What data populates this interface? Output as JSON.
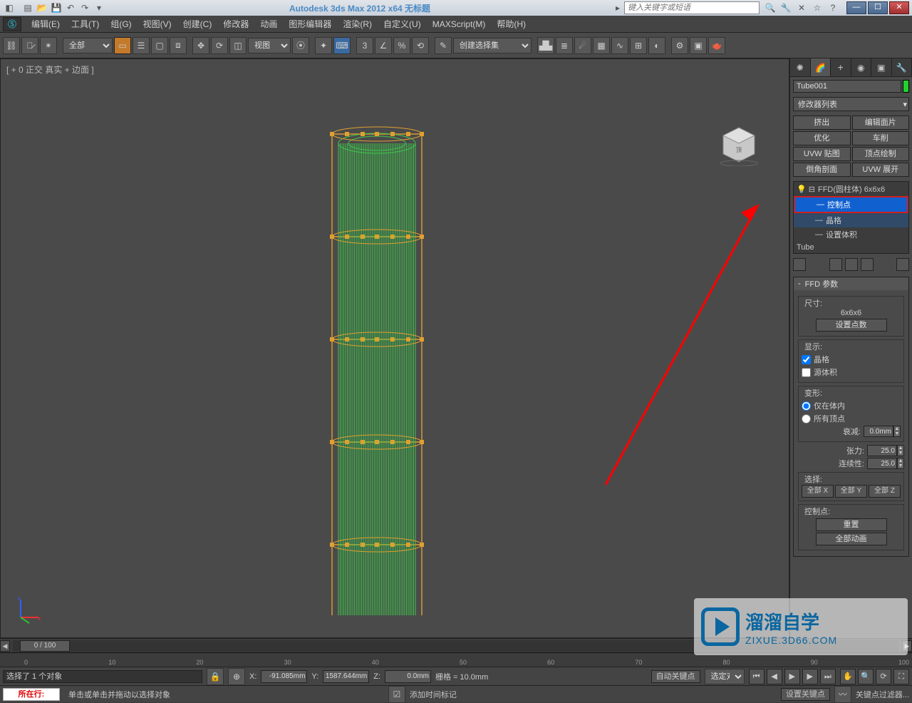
{
  "title": "Autodesk 3ds Max  2012 x64    无标题",
  "search_placeholder": "键入关键字或短语",
  "menus": [
    "编辑(E)",
    "工具(T)",
    "组(G)",
    "视图(V)",
    "创建(C)",
    "修改器",
    "动画",
    "图形编辑器",
    "渲染(R)",
    "自定义(U)",
    "MAXScript(M)",
    "帮助(H)"
  ],
  "tool_dropdowns": {
    "filter": "全部",
    "ref": "视图",
    "named_sel": "创建选择集"
  },
  "viewport_label": "[ + 0  正交  真实 + 边面 ]",
  "obj_name": "Tube001",
  "modifier_list": "修改器列表",
  "mod_buttons": [
    "挤出",
    "编辑面片",
    "优化",
    "车削",
    "UVW 贴图",
    "顶点绘制",
    "倒角剖面",
    "UVW 展开"
  ],
  "stack": {
    "top": "FFD(圆柱体) 6x6x6",
    "subs": [
      "控制点",
      "晶格",
      "设置体积"
    ],
    "base": "Tube"
  },
  "rollout_title": "FFD 参数",
  "ffd": {
    "size_label": "尺寸:",
    "size_value": "6x6x6",
    "set_points": "设置点数",
    "display_label": "显示:",
    "lattice": "晶格",
    "source_vol": "源体积",
    "deform_label": "变形:",
    "inside_only": "仅在体内",
    "all_verts": "所有顶点",
    "falloff_label": "衰减:",
    "falloff_val": "0.0mm",
    "tension_label": "张力:",
    "tension_val": "25.0",
    "continuity_label": "连续性:",
    "continuity_val": "25.0",
    "select_label": "选择:",
    "all_x": "全部 X",
    "all_y": "全部 Y",
    "all_z": "全部 Z",
    "cp_label": "控制点:",
    "reset": "重置",
    "animate_all": "全部动画"
  },
  "timeline": {
    "pos": "0 / 100",
    "ticks": [
      "0",
      "10",
      "20",
      "30",
      "40",
      "50",
      "60",
      "70",
      "80",
      "90",
      "100"
    ]
  },
  "status": {
    "sel": "选择了 1 个对象",
    "x": "-91.085mm",
    "y": "1587.644mm",
    "z": "0.0mm",
    "grid": "栅格 = 10.0mm",
    "auto_key": "自动关键点",
    "selected": "选定对",
    "set_key": "设置关键点",
    "key_filter": "关键点过滤器...",
    "add_time_tag": "添加时间标记"
  },
  "prompt": {
    "left": "所在行:",
    "text": "单击或单击并拖动以选择对象"
  },
  "watermark": {
    "big": "         溜溜自学",
    "url": "ZIXUE.3D66.COM"
  },
  "colors": {
    "accent_orange": "#e0a030",
    "accent_green": "#3cc84a",
    "bg_dark": "#4a4a4a",
    "sel_blue": "#1060d0"
  }
}
